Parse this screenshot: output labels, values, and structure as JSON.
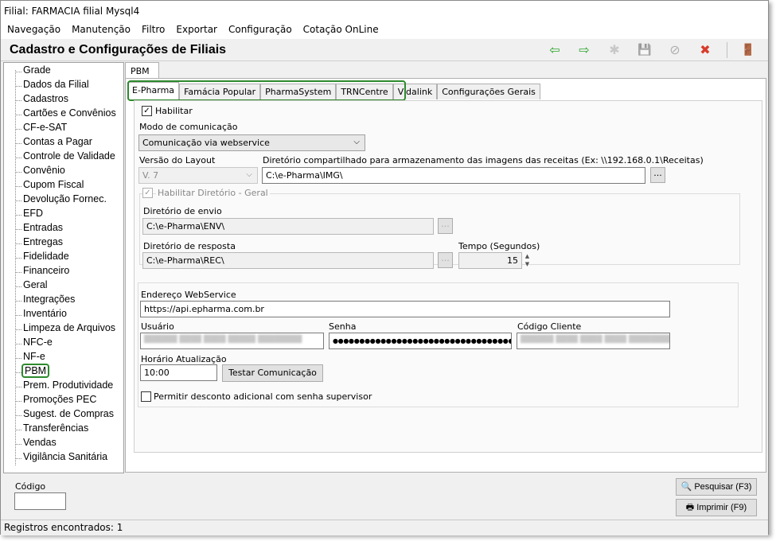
{
  "window": {
    "title": "Filial: FARMACIA filial Mysql4"
  },
  "menu": [
    "Navegação",
    "Manutenção",
    "Filtro",
    "Exportar",
    "Configuração",
    "Cotação OnLine"
  ],
  "header": {
    "title": "Cadastro e Configurações de Filiais"
  },
  "toolbar": {
    "back_icon": "arrow-left-green",
    "forward_icon": "arrow-right-green",
    "new_icon": "asterisk",
    "save_icon": "floppy",
    "cancel_icon": "no-entry",
    "delete_icon": "delete-x",
    "exit_icon": "exit-door",
    "back_glyph": "⇦",
    "forward_glyph": "⇨",
    "new_glyph": "✱",
    "save_glyph": "💾",
    "cancel_glyph": "⊘",
    "delete_glyph": "✖",
    "exit_glyph": "🚪"
  },
  "tree": [
    "Grade",
    "Dados da Filial",
    "Cadastros",
    "Cartões e Convênios",
    "CF-e-SAT",
    "Contas a Pagar",
    "Controle de Validade",
    "Convênio",
    "Cupom Fiscal",
    "Devolução Fornec.",
    "EFD",
    "Entradas",
    "Entregas",
    "Fidelidade",
    "Financeiro",
    "Geral",
    "Integrações",
    "Inventário",
    "Limpeza de Arquivos",
    "NFC-e",
    "NF-e",
    "PBM",
    "Prem. Produtividade",
    "Promoções PEC",
    "Sugest. de Compras",
    "Transferências",
    "Vendas",
    "Vigilância Sanitária"
  ],
  "outer_tab": "PBM",
  "tabs": [
    "E-Pharma",
    "Famácia Popular",
    "PharmaSystem",
    "TRNCentre",
    "Vidalink",
    "Configurações Gerais"
  ],
  "form": {
    "habilitar": "Habilitar",
    "modo_label": "Modo de comunicação",
    "modo_value": "Comunicação via webservice",
    "versao_label": "Versão do Layout",
    "versao_value": "V. 7",
    "dir_comp_label": "Diretório compartilhado para armazenamento das imagens das receitas (Ex: \\\\192.168.0.1\\Receitas)",
    "dir_comp_value": "C:\\e-Pharma\\IMG\\",
    "hab_dir_label": "Habilitar Diretório - Geral",
    "envio_label": "Diretório de envio",
    "envio_value": "C:\\e-Pharma\\ENV\\",
    "resposta_label": "Diretório de resposta",
    "resposta_value": "C:\\e-Pharma\\REC\\",
    "tempo_label": "Tempo (Segundos)",
    "tempo_value": "15",
    "endereco_label": "Endereço WebService",
    "endereco_value": "https://api.epharma.com.br",
    "usuario_label": "Usuário",
    "usuario_value": "██████ ████ ████ █████ ████████",
    "senha_label": "Senha",
    "senha_value": "●●●●●●●●●●●●●●●●●●●●●●●●●●●●●●●●●●●●",
    "codigo_cli_label": "Código Cliente",
    "codigo_cli_value": "██████ ████ ████ ████ ████████",
    "horario_label": "Horário Atualização",
    "horario_value": "10:00",
    "testar_btn": "Testar Comunicação",
    "desconto_label": "Permitir desconto adicional com senha supervisor",
    "browse": "..."
  },
  "footer": {
    "codigo_label": "Código",
    "pesquisar_btn": "Pesquisar (F3)",
    "imprimir_btn": "Imprimir (F9)",
    "search_glyph": "🔍",
    "print_glyph": "🖶"
  },
  "status": "Registros encontrados: 1",
  "colors": {
    "highlight": "#2d8a2d",
    "green_arrow": "#2aa52a",
    "delete_red": "#d83b2b"
  }
}
